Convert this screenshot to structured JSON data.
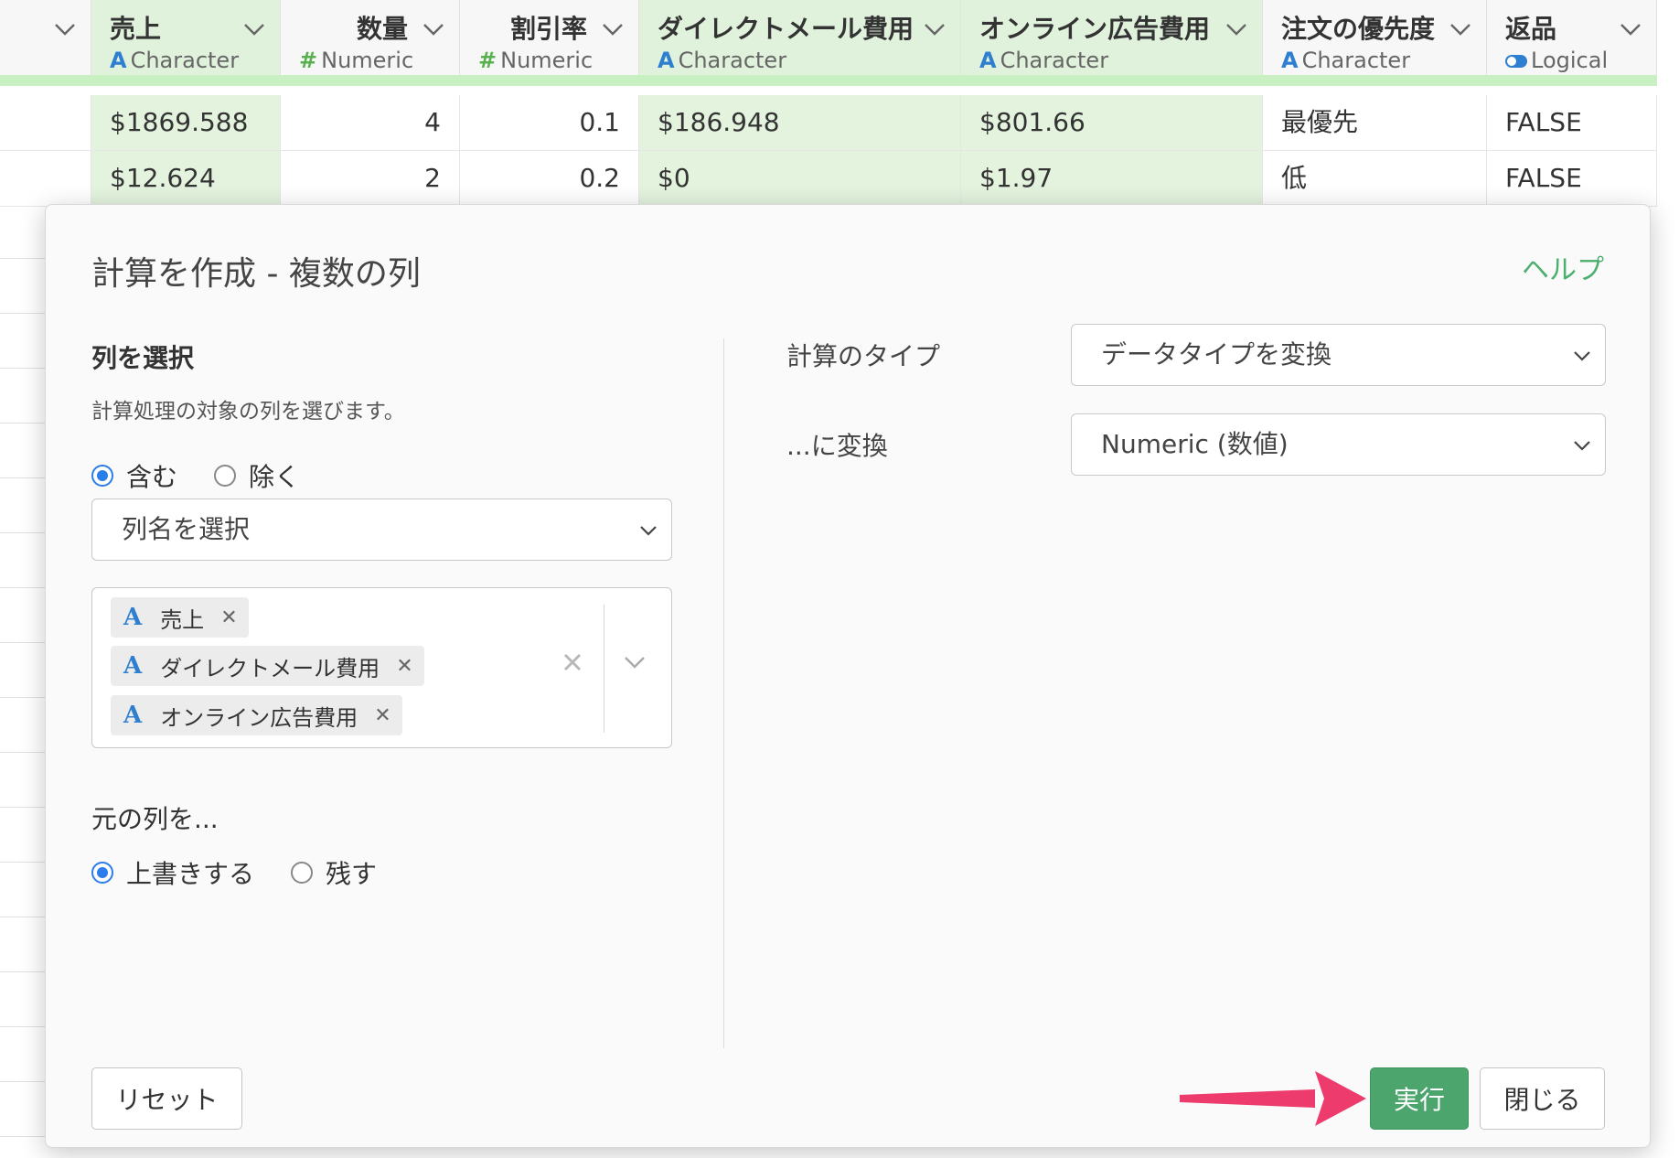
{
  "grid": {
    "columns": [
      {
        "name": "売上",
        "type": "Character",
        "type_icon": "A"
      },
      {
        "name": "数量",
        "type": "Numeric",
        "type_icon": "#"
      },
      {
        "name": "割引率",
        "type": "Numeric",
        "type_icon": "#"
      },
      {
        "name": "ダイレクトメール費用",
        "type": "Character",
        "type_icon": "A"
      },
      {
        "name": "オンライン広告費用",
        "type": "Character",
        "type_icon": "A"
      },
      {
        "name": "注文の優先度",
        "type": "Character",
        "type_icon": "A"
      },
      {
        "name": "返品",
        "type": "Logical",
        "type_icon": "toggle-icon"
      }
    ],
    "rows": [
      [
        "$1869.588",
        "4",
        "0.1",
        "$186.948",
        "$801.66",
        "最優先",
        "FALSE"
      ],
      [
        "$12.624",
        "2",
        "0.2",
        "$0",
        "$1.97",
        "低",
        "FALSE"
      ]
    ]
  },
  "modal": {
    "title": "計算を作成 - 複数の列",
    "help_link": "ヘルプ",
    "column_section": {
      "heading": "列を選択",
      "description": "計算処理の対象の列を選びます。",
      "include_label": "含む",
      "exclude_label": "除く",
      "selected_mode": "include",
      "column_select_placeholder": "列名を選択",
      "selected_columns": [
        "売上",
        "ダイレクトメール費用",
        "オンライン広告費用"
      ]
    },
    "original_section": {
      "heading": "元の列を...",
      "overwrite_label": "上書きする",
      "keep_label": "残す",
      "selected": "overwrite"
    },
    "calc_type_label": "計算のタイプ",
    "calc_type_value": "データタイプを変換",
    "convert_to_label": "...に変換",
    "convert_to_value": "Numeric (数値)",
    "buttons": {
      "reset": "リセット",
      "run": "実行",
      "close": "閉じる"
    }
  },
  "colors": {
    "accent_green": "#4ca56d",
    "selected_column_bg": "#e1f2dc",
    "header_bar": "#c9f0c2",
    "radio_blue": "#2b7de9",
    "character_icon": "#2f7fd0",
    "numeric_icon": "#58b04f",
    "annotation_arrow": "#ec3b6c"
  }
}
